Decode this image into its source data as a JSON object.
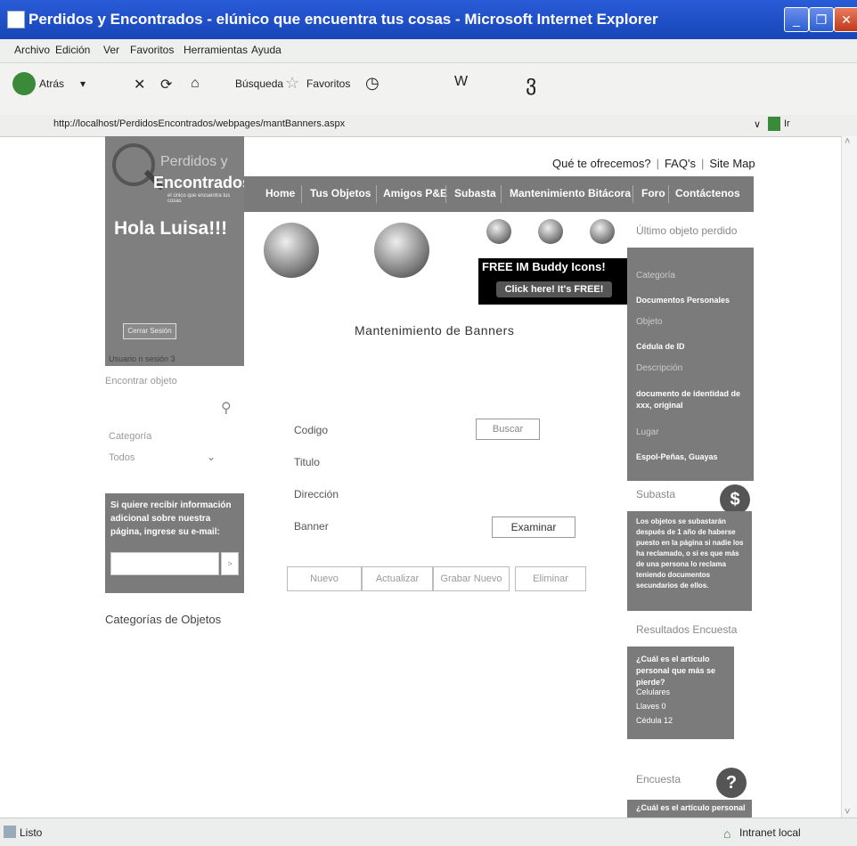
{
  "window": {
    "title": "Perdidos y Encontrados - elúnico que encuentra tus cosas - Microsoft Internet Explorer",
    "minimize": "_",
    "maximize": "❐",
    "close": "✕"
  },
  "menu": [
    "Archivo",
    "Edición",
    "Ver",
    "Favoritos",
    "Herramientas",
    "Ayuda"
  ],
  "toolbar": {
    "back": "Atrás",
    "search": "Búsqueda",
    "favorites": "Favoritos"
  },
  "address": {
    "url": "http://localhost/PerdidosEncontrados/webpages/mantBanners.aspx",
    "go": "Ir"
  },
  "status": {
    "left": "Listo",
    "right": "Intranet local"
  },
  "logo": {
    "line1": "Perdidos y",
    "line2": "Encontrados",
    "tagline": "el único que encuentra tus cosas"
  },
  "user": {
    "greeting": "Hola Luisa!!!",
    "logout": "Cerrar Sesión",
    "usuario_n": "Usuario n sesión 3"
  },
  "top_links": [
    "Qué te ofrecemos?",
    "FAQ's",
    "Site Map"
  ],
  "nav": [
    "Home",
    "Tus Objetos",
    "Amigos P&E",
    "Subasta",
    "Mantenimiento Bitácora",
    "Foro",
    "Contáctenos"
  ],
  "ad": {
    "line1": "FREE IM Buddy Icons!",
    "line2": "Click here! It's FREE!"
  },
  "left": {
    "search_label": "Encontrar objeto",
    "category_label": "Categoría",
    "category_value": "Todos",
    "info_text": "Si quiere recibir información adicional sobre nuestra página, ingrese su e-mail:",
    "go": ">",
    "categories_title": "Categorías de Objetos"
  },
  "main": {
    "title": "Mantenimiento de Banners",
    "fields": {
      "codigo": "Codigo",
      "titulo": "Titulo",
      "direccion": "Dirección",
      "banner": "Banner"
    },
    "buscar": "Buscar",
    "examinar": "Examinar",
    "buttons": [
      "Nuevo",
      "Actualizar",
      "Grabar Nuevo",
      "Eliminar"
    ]
  },
  "right": {
    "ultimo_title": "Último objeto perdido",
    "categoria_label": "Categoría",
    "categoria_value": "Documentos Personales",
    "objeto_label": "Objeto",
    "objeto_value": "Cédula de ID",
    "descripcion_label": "Descripción",
    "descripcion_value": "documento de identidad de xxx, original",
    "lugar_label": "Lugar",
    "lugar_value": "Espol-Peñas, Guayas",
    "subasta_title": "Subasta",
    "subasta_text": "Los objetos se subastarán después de 1 año de haberse puesto en la página si nadie los ha reclamado, o si es que más de una persona lo reclama teniendo documentos secundarios de ellos.",
    "resultados_title": "Resultados Encuesta",
    "resultados_q": "¿Cuál es el artículo personal que más se pierde?",
    "resultados_items": [
      "Celulares",
      "Llaves 0",
      "Cédula 12"
    ],
    "encuesta_title": "Encuesta",
    "encuesta_q": "¿Cuál es el artículo personal"
  }
}
